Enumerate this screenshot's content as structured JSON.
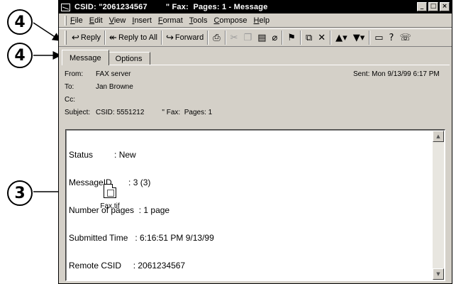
{
  "callouts": {
    "menu_callout": "4",
    "toolbar_callout": "4",
    "attachment_callout": "3"
  },
  "window": {
    "title": "CSID: \"2061234567        \" Fax:  Pages: 1 - Message",
    "controls": [
      "_",
      "□",
      "×"
    ]
  },
  "menu": [
    "File",
    "Edit",
    "View",
    "Insert",
    "Format",
    "Tools",
    "Compose",
    "Help"
  ],
  "toolbar": {
    "reply": "Reply",
    "reply_all": "Reply to All",
    "forward": "Forward"
  },
  "tabs": [
    "Message",
    "Options"
  ],
  "headers": {
    "from_label": "From:",
    "from_value": "FAX server",
    "sent_label": "Sent:",
    "sent_value": "Mon 9/13/99 6:17 PM",
    "to_label": "To:",
    "to_value": "Jan Browne",
    "cc_label": "Cc:",
    "cc_value": "",
    "subject_label": "Subject:",
    "subject_value": "CSID: 5551212         \" Fax:  Pages: 1"
  },
  "body": {
    "lines": [
      "Status         : New",
      "MessageID       : 3 (3)",
      "Number of pages  : 1 page",
      "Submitted Time   : 6:16:51 PM 9/13/99",
      "Remote CSID     : 2061234567"
    ]
  },
  "attachment": {
    "label": "Fax.tif",
    "icon": "tif-file-icon"
  }
}
